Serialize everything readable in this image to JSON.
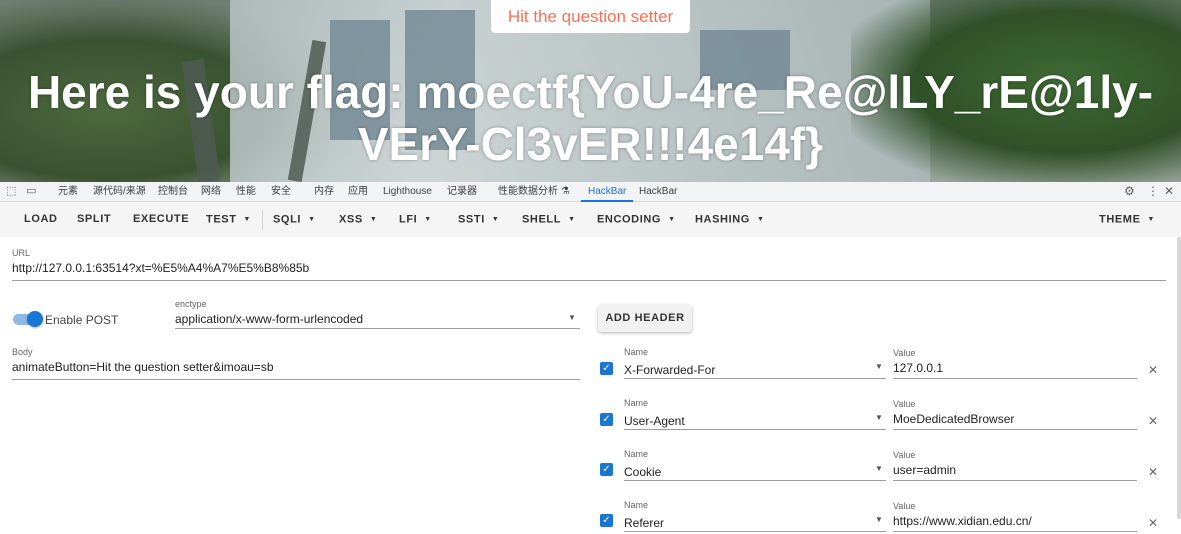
{
  "page": {
    "hit_button": "Hit the question setter",
    "flag_text": "Here is your flag: moectf{YoU-4re_Re@lLY_rE@1ly-VErY-Cl3vER!!!4e14f}"
  },
  "devtools": {
    "tabs": [
      "元素",
      "源代码/来源",
      "控制台",
      "网络",
      "性能",
      "安全",
      "内存",
      "应用",
      "Lighthouse",
      "记录器",
      "性能数据分析 ⚗",
      "HackBar",
      "HackBar"
    ],
    "active_tab": "HackBar"
  },
  "toolbar": {
    "load": "LOAD",
    "split": "SPLIT",
    "execute": "EXECUTE",
    "test": "TEST",
    "sqli": "SQLI",
    "xss": "XSS",
    "lfi": "LFI",
    "ssti": "SSTI",
    "shell": "SHELL",
    "encoding": "ENCODING",
    "hashing": "HASHING",
    "theme": "THEME"
  },
  "url": {
    "label": "URL",
    "value": "http://127.0.0.1:63514?xt=%E5%A4%A7%E5%B8%85b"
  },
  "post": {
    "toggle_label": "Enable POST",
    "enabled": true,
    "enctype_label": "enctype",
    "enctype_value": "application/x-www-form-urlencoded",
    "add_header": "ADD HEADER"
  },
  "body": {
    "label": "Body",
    "value": "animateButton=Hit the question setter&imoau=sb"
  },
  "headers": [
    {
      "name_label": "Name",
      "name": "X-Forwarded-For",
      "value_label": "Value",
      "value": "127.0.0.1",
      "checked": true
    },
    {
      "name_label": "Name",
      "name": "User-Agent",
      "value_label": "Value",
      "value": "MoeDedicatedBrowser",
      "checked": true
    },
    {
      "name_label": "Name",
      "name": "Cookie",
      "value_label": "Value",
      "value": "user=admin",
      "checked": true
    },
    {
      "name_label": "Name",
      "name": "Referer",
      "value_label": "Value",
      "value": "https://www.xidian.edu.cn/",
      "checked": true
    }
  ],
  "icons": {
    "inspect": "inspect-element-icon",
    "device": "device-toolbar-icon",
    "settings": "gear-icon",
    "more": "more-vert-icon",
    "close": "close-icon",
    "caret": "caret-down-icon",
    "checkbox": "checkbox-checked-icon"
  },
  "colors": {
    "accent": "#1976d2",
    "hit_button_text": "#ff6f4e",
    "active_tab": "#1a73e8"
  }
}
